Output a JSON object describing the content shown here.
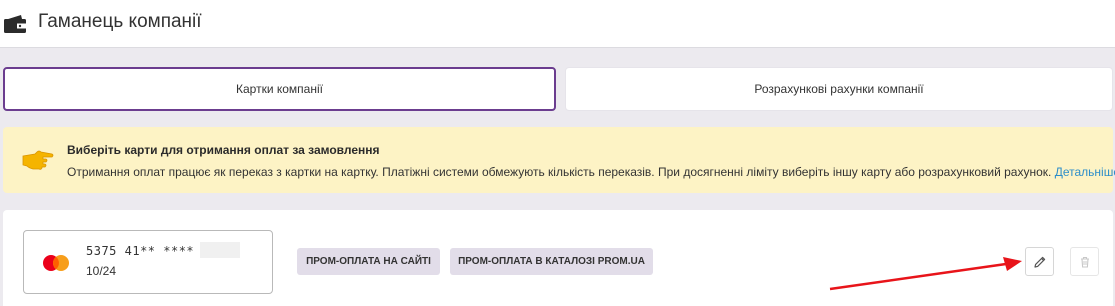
{
  "header": {
    "title": "Гаманець компанії",
    "icon": "wallet-icon"
  },
  "tabs": [
    {
      "label": "Картки компанії",
      "active": true
    },
    {
      "label": "Розрахункові рахунки компанії",
      "active": false
    }
  ],
  "notice": {
    "icon": "pointing-hand-icon",
    "title": "Виберіть карти для отримання оплат за замовлення",
    "text": "Отримання оплат працює як переказ з картки на картку. Платіжні системи обмежують кількість переказів. При досягненні ліміту виберіть іншу карту або розрахунковий рахунок.",
    "link": "Детальніше"
  },
  "card": {
    "brand_icon": "mastercard-icon",
    "number": "5375 41** ****",
    "expiry": "10/24",
    "badges": [
      "ПРОМ-ОПЛАТА НА САЙТІ",
      "ПРОМ-ОПЛАТА В КАТАЛОЗІ PROM.UA"
    ]
  },
  "colors": {
    "accent": "#6b3d8f",
    "notice_bg": "#fdf3c5",
    "link": "#2d8ec9",
    "annotation_arrow": "#e8141a"
  }
}
